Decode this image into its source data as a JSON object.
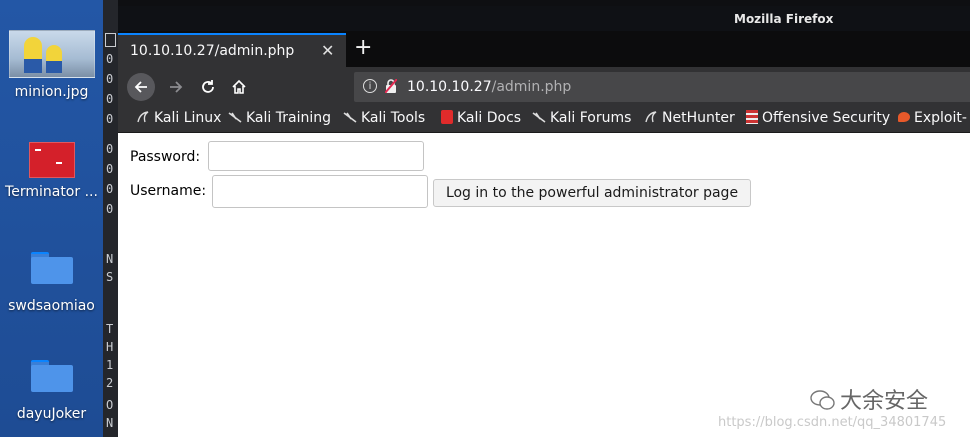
{
  "desktop": {
    "icons": [
      {
        "label": "minion.jpg"
      },
      {
        "label": "Terminator ..."
      },
      {
        "label": "swdsaomiao"
      },
      {
        "label": "dayuJoker"
      }
    ]
  },
  "terminal": {
    "lines": [
      "0",
      "0",
      "0",
      "0",
      "0",
      "0",
      "0",
      "0",
      "N",
      "S",
      "T",
      "H",
      "1",
      "2",
      "O",
      "N"
    ]
  },
  "window": {
    "title": "Mozilla Firefox",
    "tab_title": "10.10.10.27/admin.php",
    "close_symbol": "✕",
    "newtab_symbol": "+",
    "url_host": "10.10.10.27",
    "url_path": "/admin.php"
  },
  "bookmarks": [
    {
      "label": "Kali Linux",
      "icon": "kali-dragon-icon"
    },
    {
      "label": "Kali Training",
      "icon": "kali-dragon-icon"
    },
    {
      "label": "Kali Tools",
      "icon": "kali-dragon-icon"
    },
    {
      "label": "Kali Docs",
      "icon": "kali-docs-icon",
      "color": "#e02b2b"
    },
    {
      "label": "Kali Forums",
      "icon": "kali-dragon-icon"
    },
    {
      "label": "NetHunter",
      "icon": "kali-dragon-icon"
    },
    {
      "label": "Offensive Security",
      "icon": "offsec-icon"
    },
    {
      "label": "Exploit-",
      "icon": "exploitdb-icon",
      "color": "#e8592a"
    }
  ],
  "form": {
    "password_label": "Password:",
    "username_label": "Username:",
    "submit_label": "Log in to the powerful administrator page"
  },
  "watermark": {
    "brand": "大余安全",
    "url": "https://blog.csdn.net/qq_34801745"
  },
  "colors": {
    "tab_accent": "#0a84ff",
    "desktop_bg": "#1f4e92"
  }
}
